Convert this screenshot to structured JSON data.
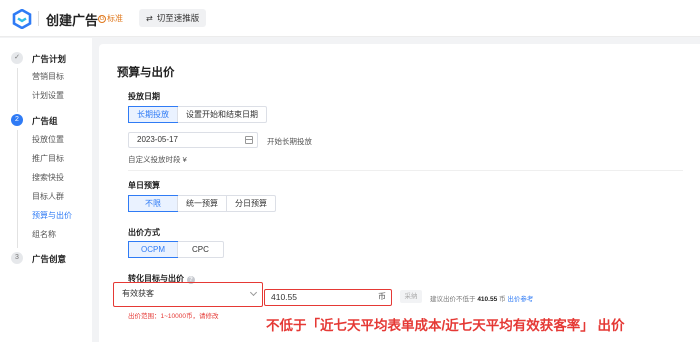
{
  "header": {
    "title": "创建广告",
    "badge": "标准",
    "badge_icon": "G",
    "switch_label": "切至速推版",
    "colors": {
      "accent": "#2f7bf5",
      "badge": "#e0781d",
      "highlight": "#e53935"
    }
  },
  "sidebar": {
    "steps": [
      {
        "num": "✓",
        "title": "广告计划",
        "items": [
          "营销目标",
          "计划设置"
        ]
      },
      {
        "num": "2",
        "title": "广告组",
        "items": [
          "投放位置",
          "推广目标",
          "搜索快投",
          "目标人群",
          "预算与出价",
          "组名称"
        ],
        "active_item": "预算与出价"
      },
      {
        "num": "3",
        "title": "广告创意",
        "items": []
      }
    ]
  },
  "main": {
    "section_title": "预算与出价",
    "schedule": {
      "label": "投放日期",
      "options": [
        "长期投放",
        "设置开始和结束日期"
      ],
      "selected": "长期投放",
      "date_value": "2023-05-17",
      "date_hint": "开始长期投放",
      "custom_time": "自定义投放时段 ¥"
    },
    "daily_budget": {
      "label": "单日预算",
      "options": [
        "不限",
        "统一预算",
        "分日预算"
      ],
      "selected": "不限"
    },
    "bid_method": {
      "label": "出价方式",
      "options": [
        "OCPM",
        "CPC"
      ],
      "selected": "OCPM"
    },
    "conversion": {
      "label": "转化目标与出价",
      "help_icon": "?",
      "goal_value": "有效获客",
      "bid_value": "410.55",
      "bid_unit": "币",
      "apply_label": "采纳",
      "suggest_prefix": "建议出价不低于",
      "suggest_value": "410.55",
      "suggest_unit": "币",
      "suggest_link": "出价参考",
      "range_hint": "出价范围：1~10000币，请修改"
    },
    "annotation": "不低于「近七天平均表单成本/近七天平均有效获客率」 出价"
  }
}
